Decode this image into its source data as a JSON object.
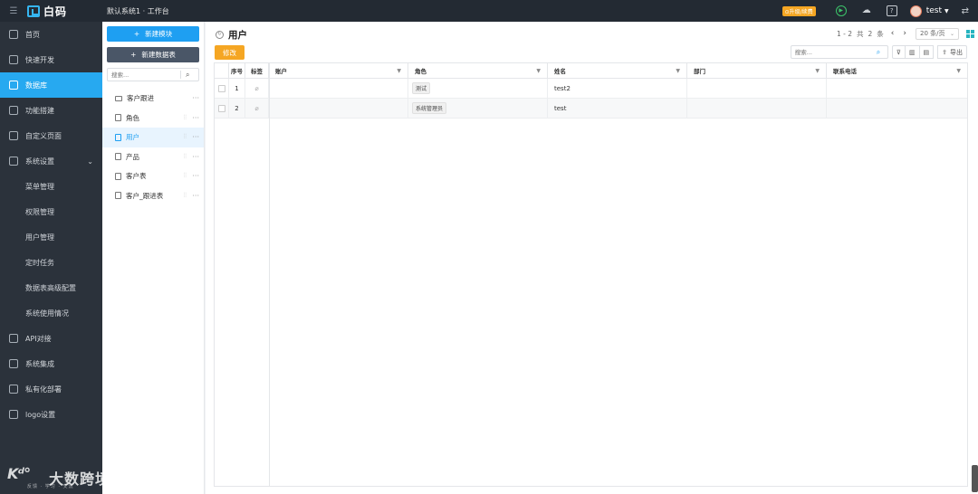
{
  "header": {
    "menu_icon": "menu-icon",
    "logo_text": "白码",
    "breadcrumb": "默认系统1 · 工作台",
    "upgrade_label": "⊙升级/续费",
    "user_name": "test"
  },
  "sidebar": {
    "items": [
      {
        "label": "首页",
        "icon": "home-icon"
      },
      {
        "label": "快速开发",
        "icon": "cube-icon"
      },
      {
        "label": "数据库",
        "icon": "database-icon",
        "active": true
      },
      {
        "label": "功能搭建",
        "icon": "build-icon"
      },
      {
        "label": "自定义页面",
        "icon": "page-icon"
      },
      {
        "label": "系统设置",
        "icon": "settings-icon",
        "expanded": true
      }
    ],
    "sub_items": [
      "菜单管理",
      "权限管理",
      "用户管理",
      "定时任务",
      "数据表高级配置",
      "系统使用情况"
    ],
    "items_after": [
      {
        "label": "API对接",
        "icon": "api-icon"
      },
      {
        "label": "系统集成",
        "icon": "integration-icon"
      },
      {
        "label": "私有化部署",
        "icon": "deploy-icon"
      },
      {
        "label": "logo设置",
        "icon": "logo-icon"
      }
    ],
    "watermark": {
      "logo": "Kᵈ°",
      "title": "大数跨境",
      "subtitle": "反馈 · 学习 · 交流"
    }
  },
  "tree": {
    "new_module_label": "新建模块",
    "new_table_label": "新建数据表",
    "search_placeholder": "搜索...",
    "nodes": [
      {
        "label": "客户跟进",
        "type": "folder"
      },
      {
        "label": "角色",
        "type": "table"
      },
      {
        "label": "用户",
        "type": "table",
        "selected": true
      },
      {
        "label": "产品",
        "type": "table"
      },
      {
        "label": "客户表",
        "type": "table"
      },
      {
        "label": "客户_跟进表",
        "type": "table"
      }
    ]
  },
  "main": {
    "title": "用户",
    "edit_label": "修改",
    "pager": {
      "range": "1 - 2",
      "total_prefix": "共",
      "total": "2",
      "total_suffix": "条",
      "page_size": "20 条/页"
    },
    "search_placeholder": "搜索...",
    "export_label": "导出",
    "columns": [
      "序号",
      "标签",
      "账户",
      "角色",
      "姓名",
      "部门",
      "联系电话"
    ],
    "rows": [
      {
        "no": "1",
        "account": "",
        "role": "测试",
        "name": "test2",
        "dept": "",
        "phone": ""
      },
      {
        "no": "2",
        "account": "",
        "role": "系统管理员",
        "name": "test",
        "dept": "",
        "phone": ""
      }
    ]
  },
  "colors": {
    "accent": "#27a9f0",
    "primary_button": "#1e9ff2",
    "edit_button": "#f5a623",
    "sidebar_bg": "#2b323b",
    "topbar_bg": "#232a33"
  }
}
